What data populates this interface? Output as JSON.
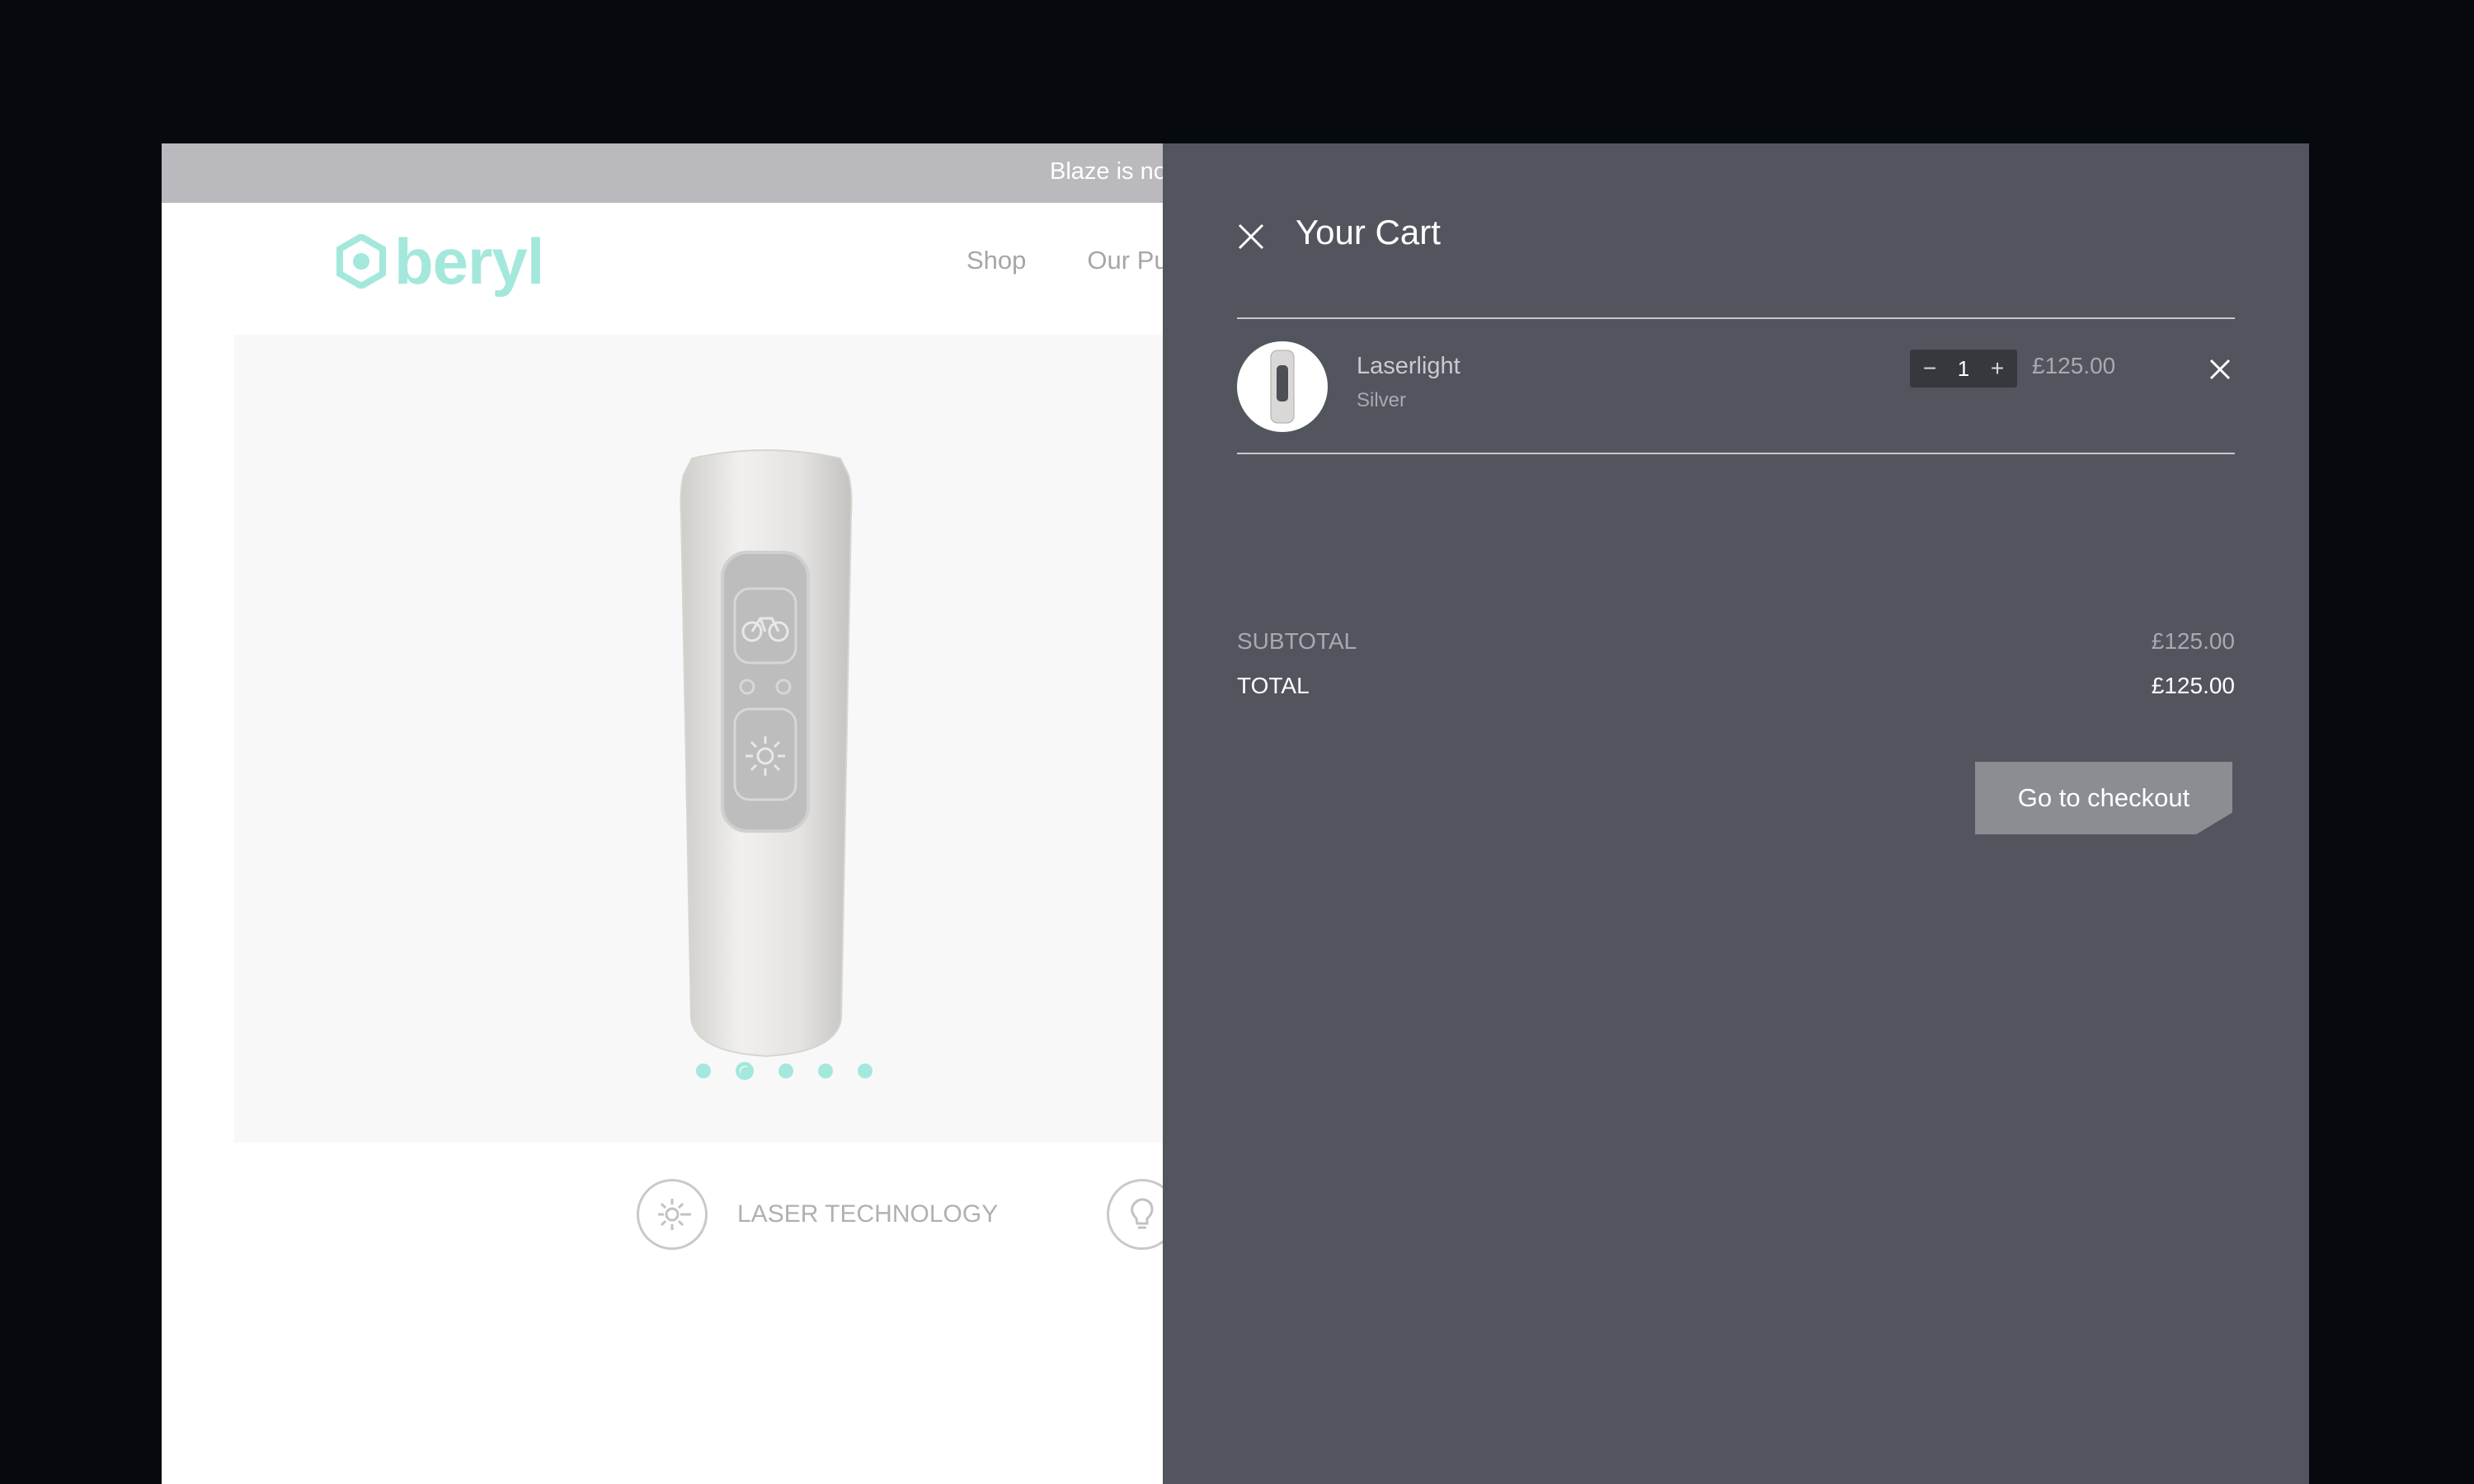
{
  "announcement": {
    "text": "Blaze is no"
  },
  "brand": {
    "name": "beryl",
    "accent_color": "#a4e8dc"
  },
  "nav": {
    "items": [
      "Shop",
      "Our Pu"
    ]
  },
  "hero": {
    "carousel_count": 5,
    "carousel_active_index": 1
  },
  "features": [
    {
      "label": "LASER TECHNOLOGY",
      "icon": "laser-sun-icon"
    },
    {
      "label": "",
      "icon": "bulb-icon"
    }
  ],
  "cart": {
    "title": "Your Cart",
    "items": [
      {
        "name": "Laserlight",
        "variant": "Silver",
        "quantity": "1",
        "price": "£125.00",
        "minus": "−",
        "plus": "+"
      }
    ],
    "subtotal_label": "SUBTOTAL",
    "subtotal_value": "£125.00",
    "total_label": "TOTAL",
    "total_value": "£125.00",
    "checkout_label": "Go to checkout"
  }
}
